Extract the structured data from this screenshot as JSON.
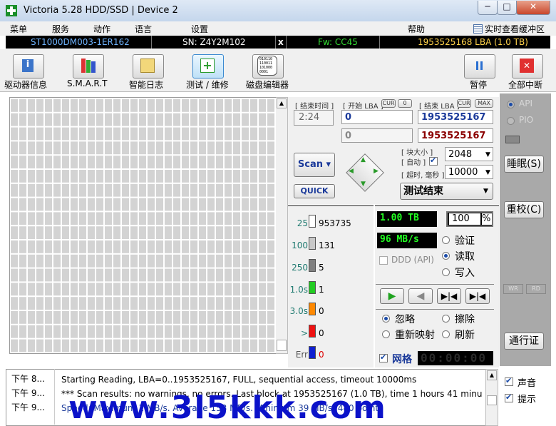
{
  "window": {
    "title": "Victoria 5.28 HDD/SSD | Device 2",
    "min_label": "─",
    "max_label": "□",
    "close_label": "✕"
  },
  "menu": {
    "items": [
      "菜单",
      "服务",
      "动作",
      "语言",
      "设置",
      "帮助"
    ],
    "buffer_view": "实时查看缓冲区"
  },
  "device": {
    "model": "ST1000DM003-1ER162",
    "serial": "SN: Z4Y2M102",
    "close": "x",
    "firmware": "Fw: CC45",
    "lba": "1953525168 LBA (1.0 TB)"
  },
  "toolbar": {
    "labels": [
      "驱动器信息",
      "S.M.A.R.T",
      "智能日志",
      "测试 / 维修",
      "磁盘编辑器",
      "暂停",
      "全部中断"
    ],
    "hex_icon_text": "010110\n110011\n101000\n0001"
  },
  "scan": {
    "end_time_label": "[ 结束时间 ]",
    "end_time": "2:24",
    "start_lba_label": "[ 开始 LBA ]",
    "end_lba_label": "[ 结束 LBA ]",
    "cur": "CUR",
    "zero": "0",
    "max": "MAX",
    "start_lba": "0",
    "start_lba2": "0",
    "end_lba": "1953525167",
    "end_lba2": "1953525167",
    "block_size_label": "[ 块大小 ]",
    "auto_label": "[ 自动 ]",
    "timeout_label": "[ 超时, 毫秒 ]",
    "block_size": "2048",
    "timeout": "10000",
    "scan_button": "Scan",
    "quick_button": "QUICK",
    "status": "测试结束"
  },
  "stats": {
    "rows": [
      {
        "label": "25",
        "count": "953735",
        "color": "#ffffff"
      },
      {
        "label": "100",
        "count": "131",
        "color": "#c8c8c8"
      },
      {
        "label": "250",
        "count": "5",
        "color": "#808080"
      },
      {
        "label": "1.0s",
        "count": "1",
        "color": "#22cc22"
      },
      {
        "label": "3.0s",
        "count": "0",
        "color": "#ff8800"
      },
      {
        "label": ">",
        "count": "0",
        "color": "#ee1111"
      },
      {
        "label": "Err",
        "count": "0",
        "color": "#1020d0"
      }
    ]
  },
  "readout": {
    "size": "1.00 TB",
    "percent": "100",
    "percent_unit": "%",
    "speed": "96 MB/s",
    "ddd": "DDD (API)",
    "verify": "验证",
    "read": "读取",
    "write": "写入"
  },
  "actions": {
    "ignore": "忽略",
    "erase": "擦除",
    "remap": "重新映射",
    "refresh": "刷新",
    "grid": "网格",
    "timer": "00:00:00"
  },
  "side": {
    "api": "API",
    "pio": "PIO",
    "sleep": "睡眠(S)",
    "recal": "重校(C)",
    "wr": "WR",
    "rd": "RD",
    "passport": "通行证"
  },
  "log": {
    "rows": [
      {
        "time": "下午 8...",
        "text": "Starting Reading, LBA=0..1953525167, FULL, sequential access, timeout 10000ms"
      },
      {
        "time": "下午 9...",
        "text": "*** Scan results: no warnings, no errors. Last block at 1953525167 (1.0 TB), time 1 hours 41 minu..."
      },
      {
        "time": "下午 9...",
        "text": "Speed: Maximum 1 MB/s. Average 153 MB/s. Minimum 39 MB/s. 480 points"
      }
    ]
  },
  "options": {
    "sound": "声音",
    "hints": "提示"
  },
  "watermark": "www.3l5kkk.com",
  "colors": {
    "lba_blue": "#1b3a9a",
    "lba_red": "#8b0000",
    "fw_green": "#33dd33",
    "lba_yellow": "#ffd24a",
    "lcd_green": "#22ff22"
  }
}
